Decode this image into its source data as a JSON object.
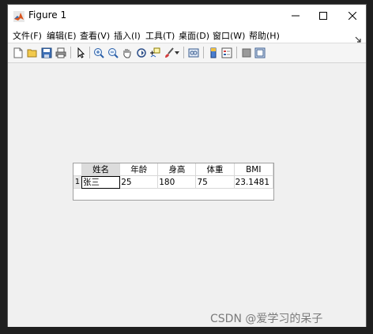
{
  "window": {
    "title": "Figure 1",
    "controls": {
      "minimize": "minimize",
      "maximize": "maximize",
      "close": "close"
    }
  },
  "menubar": {
    "items": [
      {
        "label": "文件(F)"
      },
      {
        "label": "编辑(E)"
      },
      {
        "label": "查看(V)"
      },
      {
        "label": "插入(I)"
      },
      {
        "label": "工具(T)"
      },
      {
        "label": "桌面(D)"
      },
      {
        "label": "窗口(W)"
      },
      {
        "label": "帮助(H)"
      }
    ]
  },
  "toolbar": {
    "buttons": [
      {
        "icon": "new-figure-icon"
      },
      {
        "icon": "open-folder-icon"
      },
      {
        "icon": "save-icon"
      },
      {
        "icon": "print-icon"
      },
      {
        "icon": "pointer-icon"
      },
      {
        "icon": "zoom-in-icon"
      },
      {
        "icon": "zoom-out-icon"
      },
      {
        "icon": "pan-hand-icon"
      },
      {
        "icon": "rotate-3d-icon"
      },
      {
        "icon": "data-cursor-icon"
      },
      {
        "icon": "brush-icon"
      },
      {
        "icon": "link-plot-icon"
      },
      {
        "icon": "colorbar-icon"
      },
      {
        "icon": "legend-icon"
      },
      {
        "icon": "hide-plot-tools-icon"
      },
      {
        "icon": "show-plot-tools-icon"
      }
    ]
  },
  "table": {
    "columns": [
      "姓名",
      "年龄",
      "身高",
      "体重",
      "BMI"
    ],
    "rows": [
      {
        "index": "1",
        "cells": [
          "张三",
          "25",
          "180",
          "75",
          "23.1481"
        ]
      }
    ]
  },
  "watermark": "CSDN @爱学习的呆子",
  "colors": {
    "titlebar": "#ffffff",
    "figure_bg": "#f0f0f0",
    "outer_bg": "#1f1f1f",
    "sorted_header": "#dcdcdc"
  }
}
